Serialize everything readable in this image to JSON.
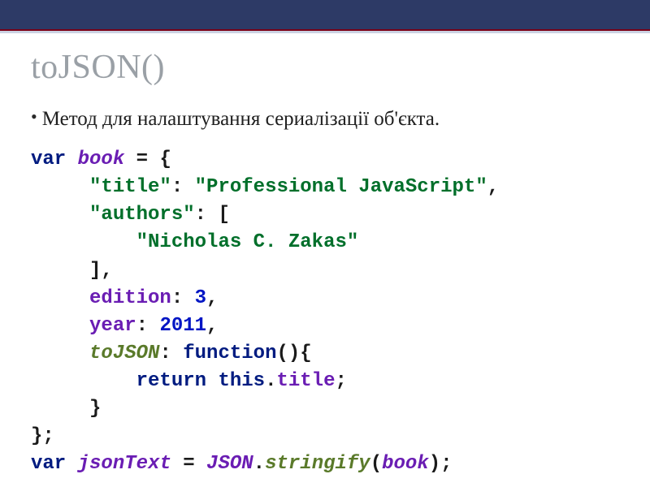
{
  "slide": {
    "title": "toJSON()",
    "bullet": "Метод для налаштування сериалізації об'єкта."
  },
  "code": {
    "kw_var1": "var",
    "book": "book",
    "eq1": " = {",
    "title_key": "\"title\"",
    "colon1": ": ",
    "title_val": "\"Professional JavaScript\"",
    "comma1": ",",
    "authors_key": "\"authors\"",
    "colon2": ": [",
    "author_val": "\"Nicholas C. Zakas\"",
    "arr_end": "],",
    "edition_key": "edition",
    "colon3": ": ",
    "edition_val": "3",
    "comma2": ",",
    "year_key": "year",
    "colon4": ": ",
    "year_val": "2011",
    "comma3": ",",
    "tojson_key": "toJSON",
    "colon5": ": ",
    "kw_function": "function",
    "fn_parens": "(){",
    "kw_return": "return",
    "kw_this": "this",
    "dot": ".",
    "title_prop": "title",
    "semi1": ";",
    "brace_close1": "}",
    "obj_close": "};",
    "kw_var2": "var",
    "jsonText": "jsonText",
    "eq2": " = ",
    "json_cls": "JSON",
    "dot2": ".",
    "stringify": "stringify",
    "paren_open": "(",
    "book_arg": "book",
    "paren_close": ");"
  }
}
